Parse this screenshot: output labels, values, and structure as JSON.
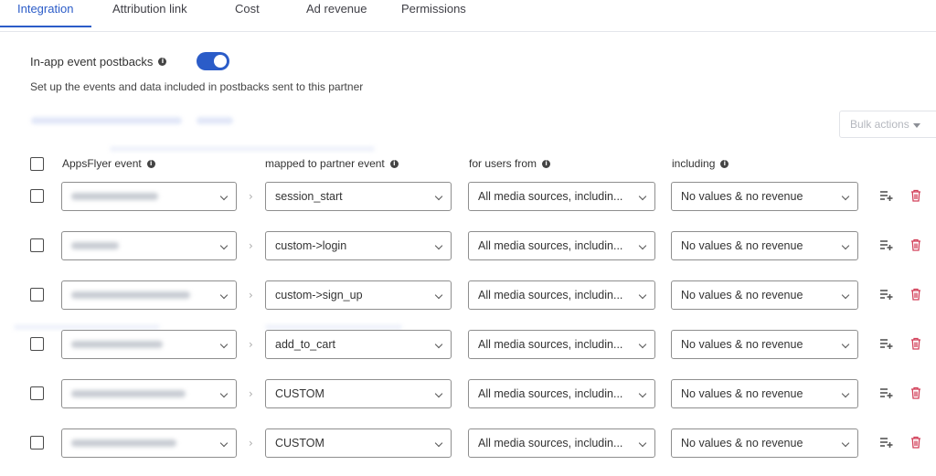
{
  "tabs": [
    {
      "label": "Integration",
      "active": true
    },
    {
      "label": "Attribution link",
      "active": false
    },
    {
      "label": "Cost",
      "active": false
    },
    {
      "label": "Ad revenue",
      "active": false
    },
    {
      "label": "Permissions",
      "active": false
    }
  ],
  "section": {
    "title": "In-app event postbacks",
    "enabled": true,
    "subtitle": "Set up the events and data included in postbacks sent to this partner"
  },
  "bulk_actions": {
    "label": "Bulk actions"
  },
  "columns": {
    "appsflyer_event": "AppsFlyer event",
    "partner_event": "mapped to partner event",
    "users_from": "for users from",
    "including": "including"
  },
  "rows": [
    {
      "partner_event": "session_start",
      "users_from": "All media sources, includin...",
      "including": "No values & no revenue"
    },
    {
      "partner_event": "custom->login",
      "users_from": "All media sources, includin...",
      "including": "No values & no revenue"
    },
    {
      "partner_event": "custom->sign_up",
      "users_from": "All media sources, includin...",
      "including": "No values & no revenue"
    },
    {
      "partner_event": "add_to_cart",
      "users_from": "All media sources, includin...",
      "including": "No values & no revenue"
    },
    {
      "partner_event": "CUSTOM",
      "users_from": "All media sources, includin...",
      "including": "No values & no revenue"
    },
    {
      "partner_event": "CUSTOM",
      "users_from": "All media sources, includin...",
      "including": "No values & no revenue"
    }
  ],
  "colors": {
    "accent": "#2b5cc8",
    "delete": "#d2415a"
  }
}
